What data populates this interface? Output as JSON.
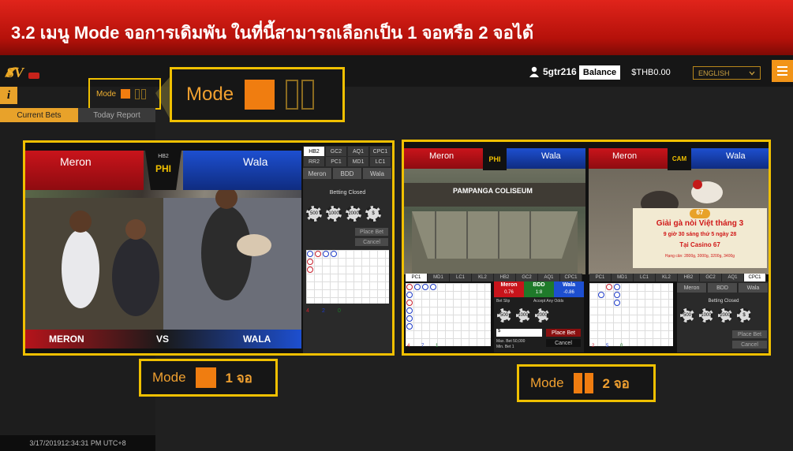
{
  "banner": {
    "title": "3.2 เมนู Mode จอการเดิมพัน ในที่นี้สามารถเลือกเป็น 1 จอหรือ 2 จอได้"
  },
  "header": {
    "username": "5gtr216",
    "balance_label": "Balance",
    "balance_value": "$THB0.00",
    "language": "ENGLISH"
  },
  "sidebar": {
    "mode_label": "Mode",
    "tab_current": "Current Bets",
    "tab_report": "Today Report",
    "timestamp": "3/17/201912:34:31 PM UTC+8"
  },
  "zoom": {
    "mode_label": "Mode"
  },
  "panel1": {
    "meron": "Meron",
    "wala": "Wala",
    "center_top": "HB2",
    "center": "PHI",
    "bottom_meron": "MERON",
    "bottom_vs": "VS",
    "bottom_wala": "WALA",
    "tabs": [
      "HB2",
      "GC2",
      "AQ1",
      "CPC1",
      "RR2",
      "PC1",
      "MD1",
      "LC1"
    ],
    "bet_choices": [
      "Meron",
      "BDD",
      "Wala"
    ],
    "status": "Betting Closed",
    "place_bet": "Place Bet",
    "cancel": "Cancel",
    "chips": [
      "500",
      "1000",
      "2000",
      "$"
    ],
    "counts": [
      "4",
      "2",
      "0"
    ]
  },
  "panel2": {
    "left": {
      "meron": "Meron",
      "wala": "Wala",
      "center": "PHI",
      "coliseum": "PAMPANGA COLISEUM",
      "tabs": [
        "PC1",
        "MD1",
        "LC1",
        "KL2",
        "HB2",
        "GC2",
        "AQ1",
        "CPC1"
      ],
      "bet_meron": "Meron",
      "bet_bdd": "BDD",
      "bet_wala": "Wala",
      "odd_meron": "0.76",
      "odd_bdd": "1:8",
      "odd_wala": "-0.86",
      "betslip": "Bet Slip",
      "accept": "Accept Any Odds",
      "place_bet": "Place Bet",
      "cancel": "Cancel",
      "max": "Max. Bet 50,000",
      "min": "Min. Bet 1",
      "amount": "$",
      "chips": [
        "500",
        "1000",
        "2000"
      ],
      "counts": [
        "4",
        "7",
        "1"
      ]
    },
    "right": {
      "meron": "Meron",
      "wala": "Wala",
      "center": "CAM",
      "promo_line1": "Giải gà nòi Việt tháng 3",
      "promo_line2": "9 giờ 30 sáng thứ 5 ngày 28",
      "promo_line3": "Tại Casino 67",
      "promo_line4": "Hạng cân: 2800g, 3000g, 3200g, 3400g",
      "promo_badge": "67",
      "tabs": [
        "PC1",
        "MD1",
        "LC1",
        "KL2",
        "HB2",
        "GC2",
        "AQ1",
        "CPC1"
      ],
      "bet_choices": [
        "Meron",
        "BDD",
        "Wala"
      ],
      "status": "Betting Closed",
      "place_bet": "Place Bet",
      "cancel": "Cancel",
      "chips": [
        "500",
        "1000",
        "2000",
        "$"
      ],
      "counts": [
        "2",
        "5",
        "0"
      ]
    }
  },
  "captions": {
    "mode1_label": "Mode",
    "mode1_num": "1 จอ",
    "mode2_label": "Mode",
    "mode2_num": "2 จอ"
  }
}
